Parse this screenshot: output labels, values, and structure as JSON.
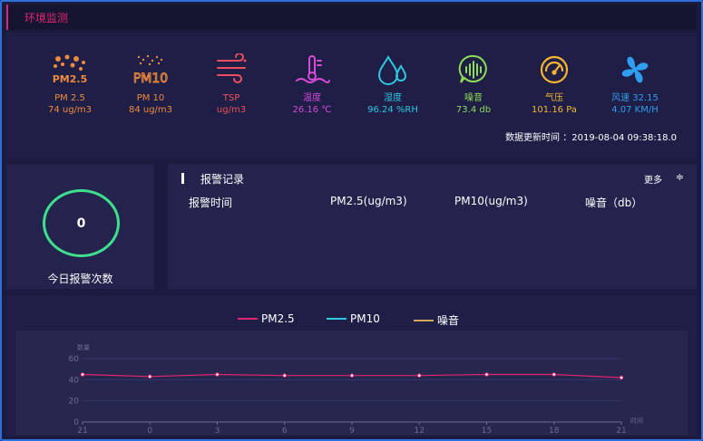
{
  "header": {
    "title": "环境监测"
  },
  "sensors": [
    {
      "icon": "pm25-icon",
      "label": "PM 2.5",
      "value": "74 ug/m3",
      "color": "#f08a3c"
    },
    {
      "icon": "pm10-icon",
      "label": "PM 10",
      "value": "84 ug/m3",
      "color": "#f08a3c"
    },
    {
      "icon": "tsp-icon",
      "label": "TSP",
      "value": "ug/m3",
      "color": "#ef4f5a"
    },
    {
      "icon": "thermometer-icon",
      "label": "温度",
      "value": "26.16 ℃",
      "color": "#d54bd8"
    },
    {
      "icon": "humidity-icon",
      "label": "湿度",
      "value": "96.24 %RH",
      "color": "#2ec7e0"
    },
    {
      "icon": "noise-icon",
      "label": "噪音",
      "value": "73.4 db",
      "color": "#8fdc55"
    },
    {
      "icon": "gauge-icon",
      "label": "气压",
      "value": "101.16 Pa",
      "color": "#f5b531"
    },
    {
      "icon": "fan-icon",
      "label": "风速  32.15",
      "value": "4.07 KM/H",
      "color": "#2f9df0"
    }
  ],
  "update": {
    "label": "数据更新时间 ：",
    "time": "2019-08-04 09:38:18.0"
  },
  "alarm_count": {
    "value": "0",
    "label": "今日报警次数"
  },
  "records": {
    "title": "报警记录",
    "more": "更多",
    "columns": [
      "报警时间",
      "PM2.5(ug/m3)",
      "PM10(ug/m3)",
      "噪音（db）"
    ]
  },
  "chart_data": {
    "type": "line",
    "ylabel": "数量",
    "xlabel": "时间",
    "ylim": [
      0,
      60
    ],
    "yticks": [
      0,
      20,
      40,
      60
    ],
    "x": [
      "21",
      "0",
      "3",
      "6",
      "9",
      "12",
      "15",
      "18",
      "21"
    ],
    "series": [
      {
        "name": "PM2.5",
        "color": "#e0256f",
        "values": [
          45,
          43,
          45,
          44,
          44,
          44,
          45,
          45,
          42
        ]
      },
      {
        "name": "PM10",
        "color": "#2ec7e0",
        "values": []
      },
      {
        "name": "噪音",
        "color": "#d4a85a",
        "values": []
      }
    ]
  }
}
